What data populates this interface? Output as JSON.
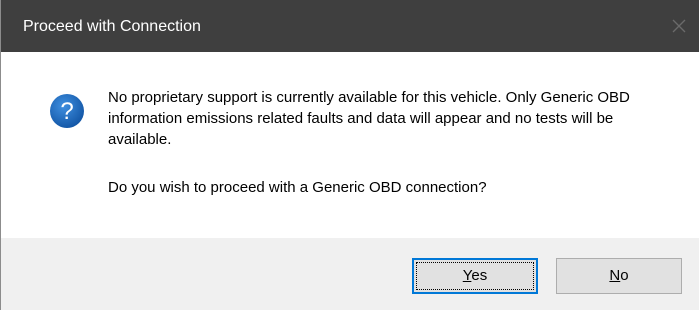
{
  "window": {
    "title": "Proceed with Connection",
    "close_icon": "close-icon"
  },
  "message": {
    "icon": "question-icon",
    "body": "No proprietary support is currently available for this vehicle.  Only Generic OBD information emissions related faults and data will appear and no tests will be available.",
    "question": "Do you wish to proceed with a Generic OBD connection?"
  },
  "buttons": {
    "yes": {
      "accel": "Y",
      "rest": "es",
      "default": true
    },
    "no": {
      "accel": "N",
      "rest": "o"
    }
  },
  "colors": {
    "titlebar": "#3f3f3f",
    "footer": "#f0f0f0",
    "icon": "#1e6fbf",
    "focus_border": "#0078d7"
  }
}
